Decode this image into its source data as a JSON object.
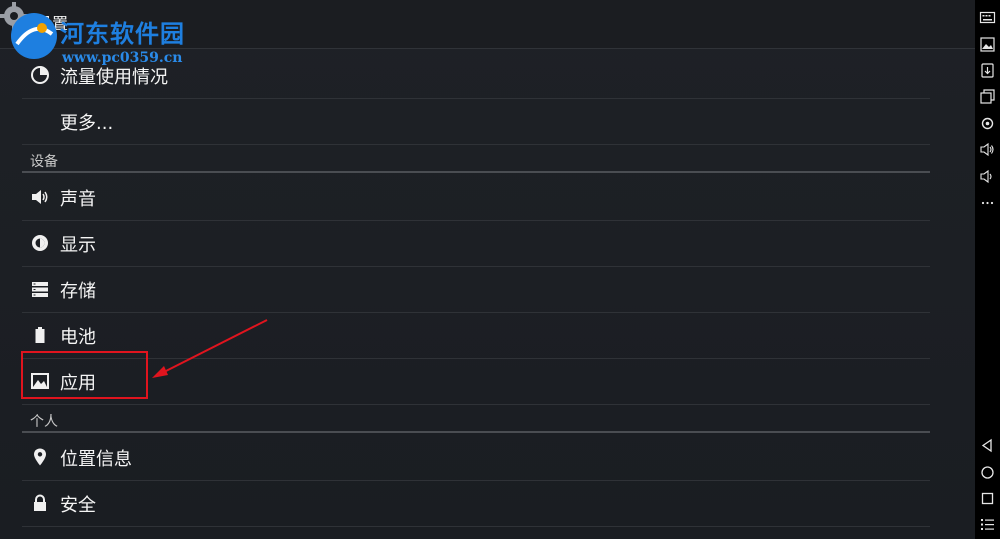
{
  "actionbar": {
    "title": "设置"
  },
  "watermark": {
    "name": "河东软件园",
    "url": "www.pc0359.cn"
  },
  "items": {
    "data_usage": "流量使用情况",
    "more": "更多...",
    "sound": "声音",
    "display": "显示",
    "storage": "存储",
    "battery": "电池",
    "apps": "应用",
    "location": "位置信息",
    "security": "安全"
  },
  "headers": {
    "device": "设备",
    "personal": "个人"
  },
  "colors": {
    "highlight": "#e0141e",
    "watermark_blue": "#1e7fe0"
  },
  "icons": {
    "data_usage": "pie-chart-icon",
    "sound": "speaker-icon",
    "display": "brightness-icon",
    "storage": "storage-icon",
    "battery": "battery-icon",
    "apps": "apps-icon",
    "location": "location-pin-icon",
    "security": "lock-icon"
  }
}
